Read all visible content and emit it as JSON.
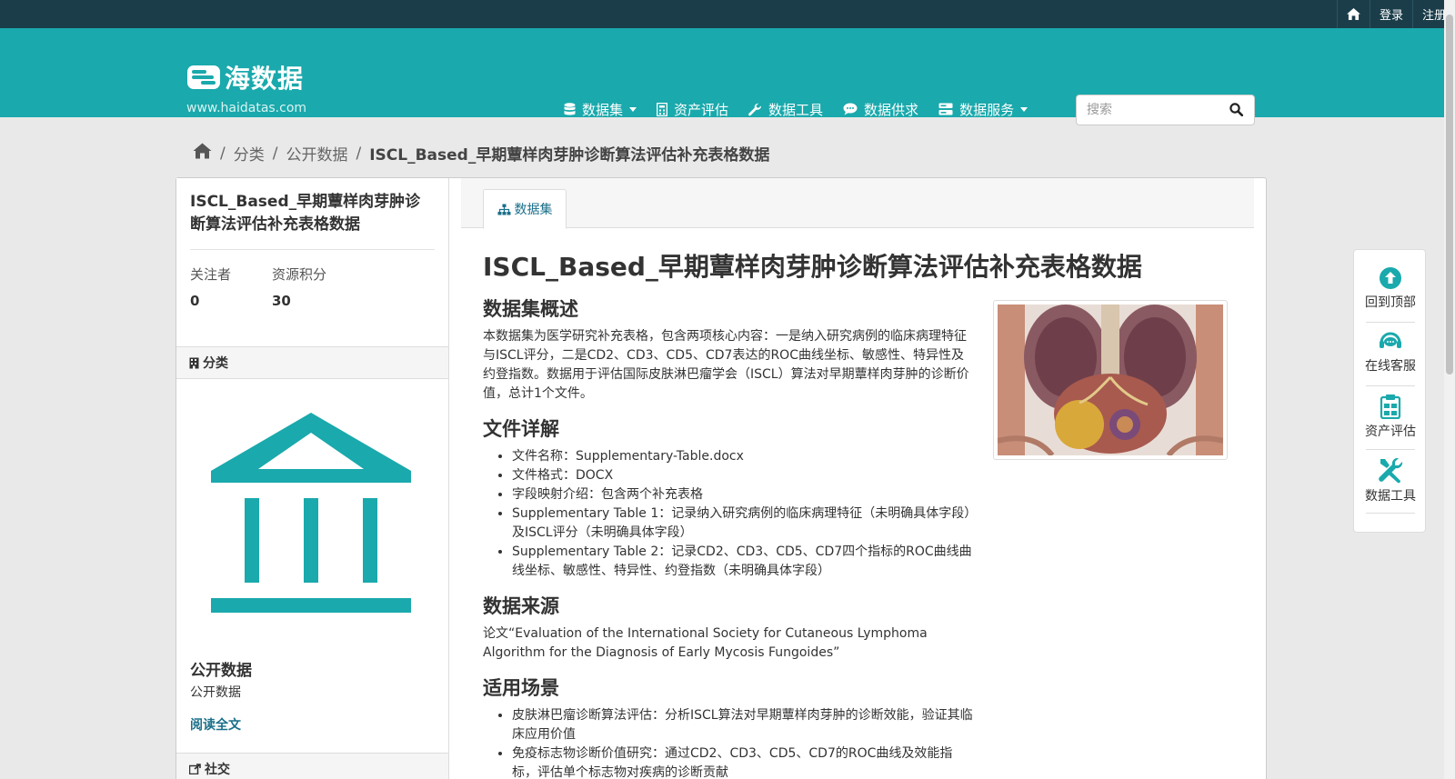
{
  "topbar": {
    "login": "登录",
    "register": "注册"
  },
  "brand": {
    "name": "海数据",
    "url": "www.haidatas.com"
  },
  "nav": {
    "items": [
      {
        "label": "数据集",
        "icon": "database-icon",
        "dropdown": true
      },
      {
        "label": "资产评估",
        "icon": "calculator-icon",
        "dropdown": false
      },
      {
        "label": "数据工具",
        "icon": "wrench-icon",
        "dropdown": false
      },
      {
        "label": "数据供求",
        "icon": "chat-icon",
        "dropdown": false
      },
      {
        "label": "数据服务",
        "icon": "server-icon",
        "dropdown": true
      }
    ],
    "search_placeholder": "搜索"
  },
  "breadcrumb": {
    "items": [
      "分类",
      "公开数据"
    ],
    "current": "ISCL_Based_早期蕈样肉芽肿诊断算法评估补充表格数据"
  },
  "sidebar": {
    "title": "ISCL_Based_早期蕈样肉芽肿诊断算法评估补充表格数据",
    "followers_label": "关注者",
    "followers_value": "0",
    "points_label": "资源积分",
    "points_value": "30",
    "category_heading": "分类",
    "org_name": "公开数据",
    "org_desc": "公开数据",
    "read_more": "阅读全文",
    "social_heading": "社交"
  },
  "tabs": {
    "dataset": "数据集"
  },
  "dataset": {
    "title": "ISCL_Based_早期蕈样肉芽肿诊断算法评估补充表格数据",
    "overview_heading": "数据集概述",
    "overview_text": "本数据集为医学研究补充表格，包含两项核心内容：一是纳入研究病例的临床病理特征与ISCL评分，二是CD2、CD3、CD5、CD7表达的ROC曲线坐标、敏感性、特异性及约登指数。数据用于评估国际皮肤淋巴瘤学会（ISCL）算法对早期蕈样肉芽肿的诊断价值，总计1个文件。",
    "files_heading": "文件详解",
    "files_items": [
      "文件名称：Supplementary-Table.docx",
      "文件格式：DOCX",
      "字段映射介绍：包含两个补充表格",
      "Supplementary Table 1：记录纳入研究病例的临床病理特征（未明确具体字段）及ISCL评分（未明确具体字段）",
      "Supplementary Table 2：记录CD2、CD3、CD5、CD7四个指标的ROC曲线曲线坐标、敏感性、特异性、约登指数（未明确具体字段）"
    ],
    "source_heading": "数据来源",
    "source_text": "论文“Evaluation of the International Society for Cutaneous Lymphoma Algorithm for the Diagnosis of Early Mycosis Fungoides”",
    "usage_heading": "适用场景",
    "usage_items": [
      "皮肤淋巴瘤诊断算法评估：分析ISCL算法对早期蕈样肉芽肿的诊断效能，验证其临床应用价值",
      "免疫标志物诊断价值研究：通过CD2、CD3、CD5、CD7的ROC曲线及效能指标，评估单个标志物对疾病的诊断贡献"
    ]
  },
  "float_panel": {
    "items": [
      {
        "label": "回到顶部",
        "icon": "arrow-up-circle-icon"
      },
      {
        "label": "在线客服",
        "icon": "headset-icon"
      },
      {
        "label": "资产评估",
        "icon": "clipboard-icon"
      },
      {
        "label": "数据工具",
        "icon": "tools-icon"
      }
    ]
  },
  "colors": {
    "topbar": "#1b3d4a",
    "header": "#1aa9ac",
    "accent": "#1a6f8a",
    "icon_teal": "#1aa9ac"
  }
}
